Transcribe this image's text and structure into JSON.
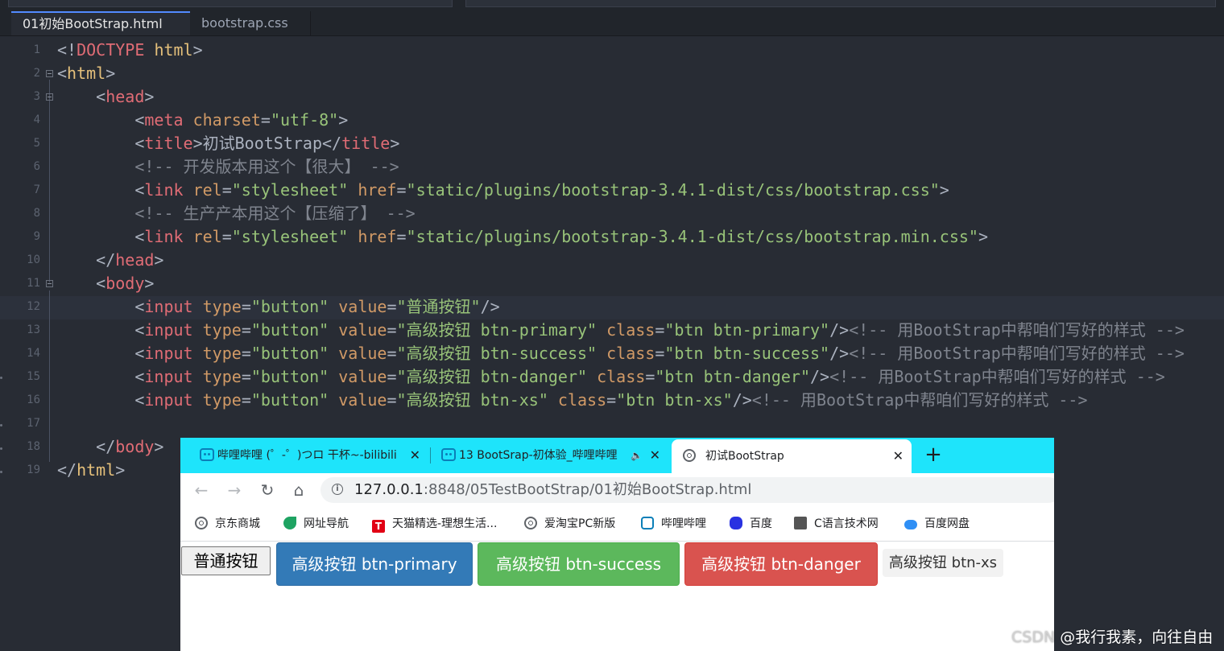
{
  "editor": {
    "tabs": [
      {
        "label": "01初始BootStrap.html",
        "active": true
      },
      {
        "label": "bootstrap.css",
        "active": false
      }
    ],
    "current_line": 12,
    "lines": [
      {
        "n": "1",
        "tokens": [
          [
            "br",
            "<!"
          ],
          [
            "tagr",
            "DOCTYPE"
          ],
          [
            "br",
            " "
          ],
          [
            "tag",
            "html"
          ],
          [
            "br",
            ">"
          ]
        ]
      },
      {
        "n": "2",
        "tokens": [
          [
            "br",
            "<"
          ],
          [
            "tag",
            "html"
          ],
          [
            "br",
            ">"
          ]
        ]
      },
      {
        "n": "3",
        "tokens": [
          [
            "br",
            "    <"
          ],
          [
            "tagr",
            "head"
          ],
          [
            "br",
            ">"
          ]
        ]
      },
      {
        "n": "4",
        "tokens": [
          [
            "br",
            "        <"
          ],
          [
            "tagr",
            "meta"
          ],
          [
            "br",
            " "
          ],
          [
            "att",
            "charset"
          ],
          [
            "br",
            "="
          ],
          [
            "str",
            "\"utf-8\""
          ],
          [
            "br",
            ">"
          ]
        ]
      },
      {
        "n": "5",
        "tokens": [
          [
            "br",
            "        <"
          ],
          [
            "tagr",
            "title"
          ],
          [
            "br",
            ">"
          ],
          [
            "txt",
            "初试BootStrap"
          ],
          [
            "br",
            "</"
          ],
          [
            "tagr",
            "title"
          ],
          [
            "br",
            ">"
          ]
        ]
      },
      {
        "n": "6",
        "tokens": [
          [
            "com",
            "        <!-- 开发版本用这个【很大】 -->"
          ]
        ]
      },
      {
        "n": "7",
        "tokens": [
          [
            "br",
            "        <"
          ],
          [
            "tagr",
            "link"
          ],
          [
            "br",
            " "
          ],
          [
            "att",
            "rel"
          ],
          [
            "br",
            "="
          ],
          [
            "str",
            "\"stylesheet\""
          ],
          [
            "br",
            " "
          ],
          [
            "att",
            "href"
          ],
          [
            "br",
            "="
          ],
          [
            "str",
            "\"static/plugins/bootstrap-3.4.1-dist/css/bootstrap.css\""
          ],
          [
            "br",
            ">"
          ]
        ]
      },
      {
        "n": "8",
        "tokens": [
          [
            "com",
            "        <!-- 生产产本用这个【压缩了】 -->"
          ]
        ]
      },
      {
        "n": "9",
        "tokens": [
          [
            "br",
            "        <"
          ],
          [
            "tagr",
            "link"
          ],
          [
            "br",
            " "
          ],
          [
            "att",
            "rel"
          ],
          [
            "br",
            "="
          ],
          [
            "str",
            "\"stylesheet\""
          ],
          [
            "br",
            " "
          ],
          [
            "att",
            "href"
          ],
          [
            "br",
            "="
          ],
          [
            "str",
            "\"static/plugins/bootstrap-3.4.1-dist/css/bootstrap.min.css\""
          ],
          [
            "br",
            ">"
          ]
        ]
      },
      {
        "n": "10",
        "tokens": [
          [
            "br",
            "    </"
          ],
          [
            "tagr",
            "head"
          ],
          [
            "br",
            ">"
          ]
        ]
      },
      {
        "n": "11",
        "tokens": [
          [
            "br",
            "    <"
          ],
          [
            "tagr",
            "body"
          ],
          [
            "br",
            ">"
          ]
        ]
      },
      {
        "n": "12",
        "tokens": [
          [
            "br",
            "        <"
          ],
          [
            "tagr",
            "input"
          ],
          [
            "br",
            " "
          ],
          [
            "att",
            "type"
          ],
          [
            "br",
            "="
          ],
          [
            "str",
            "\"button\""
          ],
          [
            "br",
            " "
          ],
          [
            "att",
            "value"
          ],
          [
            "br",
            "="
          ],
          [
            "str",
            "\"普通按钮\""
          ],
          [
            "br",
            "/>"
          ]
        ]
      },
      {
        "n": "13",
        "tokens": [
          [
            "br",
            "        <"
          ],
          [
            "tagr",
            "input"
          ],
          [
            "br",
            " "
          ],
          [
            "att",
            "type"
          ],
          [
            "br",
            "="
          ],
          [
            "str",
            "\"button\""
          ],
          [
            "br",
            " "
          ],
          [
            "att",
            "value"
          ],
          [
            "br",
            "="
          ],
          [
            "str",
            "\"高级按钮 btn-primary\""
          ],
          [
            "br",
            " "
          ],
          [
            "att",
            "class"
          ],
          [
            "br",
            "="
          ],
          [
            "str",
            "\"btn btn-primary\""
          ],
          [
            "br",
            "/>"
          ],
          [
            "com",
            "<!-- 用BootStrap中帮咱们写好的样式 -->"
          ]
        ]
      },
      {
        "n": "14",
        "tokens": [
          [
            "br",
            "        <"
          ],
          [
            "tagr",
            "input"
          ],
          [
            "br",
            " "
          ],
          [
            "att",
            "type"
          ],
          [
            "br",
            "="
          ],
          [
            "str",
            "\"button\""
          ],
          [
            "br",
            " "
          ],
          [
            "att",
            "value"
          ],
          [
            "br",
            "="
          ],
          [
            "str",
            "\"高级按钮 btn-success\""
          ],
          [
            "br",
            " "
          ],
          [
            "att",
            "class"
          ],
          [
            "br",
            "="
          ],
          [
            "str",
            "\"btn btn-success\""
          ],
          [
            "br",
            "/>"
          ],
          [
            "com",
            "<!-- 用BootStrap中帮咱们写好的样式 -->"
          ]
        ]
      },
      {
        "n": "15",
        "tokens": [
          [
            "br",
            "        <"
          ],
          [
            "tagr",
            "input"
          ],
          [
            "br",
            " "
          ],
          [
            "att",
            "type"
          ],
          [
            "br",
            "="
          ],
          [
            "str",
            "\"button\""
          ],
          [
            "br",
            " "
          ],
          [
            "att",
            "value"
          ],
          [
            "br",
            "="
          ],
          [
            "str",
            "\"高级按钮 btn-danger\""
          ],
          [
            "br",
            " "
          ],
          [
            "att",
            "class"
          ],
          [
            "br",
            "="
          ],
          [
            "str",
            "\"btn btn-danger\""
          ],
          [
            "br",
            "/>"
          ],
          [
            "com",
            "<!-- 用BootStrap中帮咱们写好的样式 -->"
          ]
        ]
      },
      {
        "n": "16",
        "tokens": [
          [
            "br",
            "        <"
          ],
          [
            "tagr",
            "input"
          ],
          [
            "br",
            " "
          ],
          [
            "att",
            "type"
          ],
          [
            "br",
            "="
          ],
          [
            "str",
            "\"button\""
          ],
          [
            "br",
            " "
          ],
          [
            "att",
            "value"
          ],
          [
            "br",
            "="
          ],
          [
            "str",
            "\"高级按钮 btn-xs\""
          ],
          [
            "br",
            " "
          ],
          [
            "att",
            "class"
          ],
          [
            "br",
            "="
          ],
          [
            "str",
            "\"btn btn-xs\""
          ],
          [
            "br",
            "/>"
          ],
          [
            "com",
            "<!-- 用BootStrap中帮咱们写好的样式 -->"
          ]
        ]
      },
      {
        "n": "17",
        "tokens": []
      },
      {
        "n": "18",
        "tokens": [
          [
            "br",
            "    </"
          ],
          [
            "tagr",
            "body"
          ],
          [
            "br",
            ">"
          ]
        ]
      },
      {
        "n": "19",
        "tokens": [
          [
            "br",
            "</"
          ],
          [
            "tag",
            "html"
          ],
          [
            "br",
            ">"
          ]
        ]
      }
    ]
  },
  "browser": {
    "tabs": [
      {
        "label": "哔哩哔哩 (゜-゜)つロ 干杯~-bilibili",
        "icon": "bilibili-icon",
        "close": "✕"
      },
      {
        "label": "13 BootSrap-初体验_哔哩哔哩",
        "icon": "bilibili-icon",
        "close": "✕",
        "audio": "🔈"
      },
      {
        "label": "初试BootStrap",
        "icon": "globe-icon",
        "close": "✕",
        "active": true
      }
    ],
    "new_tab": "+",
    "nav": {
      "back": "←",
      "forward": "→",
      "reload": "↻",
      "home": "⌂"
    },
    "url_host": "127.0.0.1",
    "url_rest": ":8848/05TestBootStrap/01初始BootStrap.html",
    "bookmarks": [
      {
        "label": "京东商城",
        "icon": "globe-icon"
      },
      {
        "label": "网址导航",
        "icon": "leaf-icon"
      },
      {
        "label": "天猫精选-理想生活...",
        "icon": "tmall-icon"
      },
      {
        "label": "爱淘宝PC新版",
        "icon": "globe-icon"
      },
      {
        "label": "哔哩哔哩",
        "icon": "bilibili-icon"
      },
      {
        "label": "百度",
        "icon": "baidu-paw-icon"
      },
      {
        "label": "C语言技术网",
        "icon": "c-language-icon"
      },
      {
        "label": "百度网盘",
        "icon": "cloud-icon"
      }
    ],
    "page_buttons": {
      "plain": "普通按钮",
      "primary": "高级按钮 btn-primary",
      "success": "高级按钮 btn-success",
      "danger": "高级按钮 btn-danger",
      "xs": "高级按钮 btn-xs"
    }
  },
  "watermark": {
    "prefix": "CSDN",
    "text": " @我行我素，向往自由"
  },
  "colors": {
    "editor_bg": "#282c34",
    "browser_tabstrip": "#1ee4fb",
    "btn_primary": "#337ab7",
    "btn_success": "#5cb85c",
    "btn_danger": "#d9534f"
  }
}
